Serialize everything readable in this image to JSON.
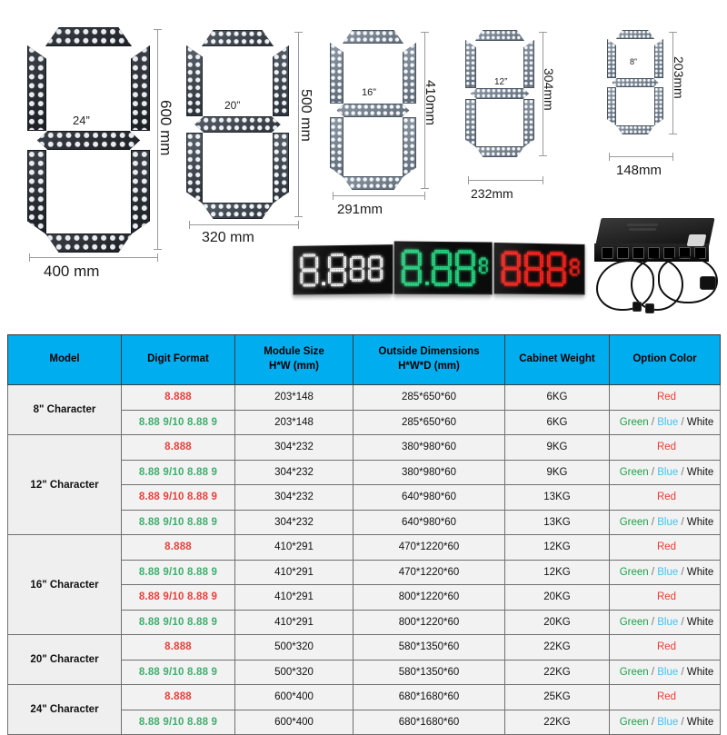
{
  "diagram": {
    "digits": [
      {
        "id": "24in",
        "inch_label": "24”",
        "height_label": "600 mm",
        "width_label": "400 mm",
        "tone": "dark"
      },
      {
        "id": "20in",
        "inch_label": "20”",
        "height_label": "500 mm",
        "width_label": "320 mm",
        "tone": "mid"
      },
      {
        "id": "16in",
        "inch_label": "16”",
        "height_label": "410mm",
        "width_label": "291mm",
        "tone": "light"
      },
      {
        "id": "12in",
        "inch_label": "12”",
        "height_label": "304mm",
        "width_label": "232mm",
        "tone": "light"
      },
      {
        "id": "8in",
        "inch_label": "8”",
        "height_label": "203mm",
        "width_label": "148mm",
        "tone": "light"
      }
    ]
  },
  "signs": [
    {
      "id": "white-sign",
      "color": "#f0f0f0",
      "digits": "8.888"
    },
    {
      "id": "green-sign",
      "color": "#25d07d",
      "digits": "8.88 9"
    },
    {
      "id": "red-sign",
      "color": "#f0231d",
      "digits": "888 9/10"
    }
  ],
  "psu": {
    "name": "led-power-supply-controller"
  },
  "table": {
    "headers": [
      {
        "line1": "Model",
        "line2": ""
      },
      {
        "line1": "Digit Format",
        "line2": ""
      },
      {
        "line1": "Module Size",
        "line2": "H*W (mm)"
      },
      {
        "line1": "Outside Dimensions",
        "line2": "H*W*D (mm)"
      },
      {
        "line1": "Cabinet Weight",
        "line2": ""
      },
      {
        "line1": "Option Color",
        "line2": ""
      }
    ],
    "groups": [
      {
        "model": "8\" Character",
        "rows": [
          {
            "format": "8.888",
            "format_color": "red",
            "module": "203*148",
            "outside": "285*650*60",
            "weight": "6KG",
            "option": "red"
          },
          {
            "format": "8.88 9/10  8.88 9",
            "format_color": "green",
            "module": "203*148",
            "outside": "285*650*60",
            "weight": "6KG",
            "option": "gbw"
          }
        ]
      },
      {
        "model": "12\" Character",
        "rows": [
          {
            "format": "8.888",
            "format_color": "red",
            "module": "304*232",
            "outside": "380*980*60",
            "weight": "9KG",
            "option": "red"
          },
          {
            "format": "8.88 9/10  8.88 9",
            "format_color": "green",
            "module": "304*232",
            "outside": "380*980*60",
            "weight": "9KG",
            "option": "gbw"
          },
          {
            "format": "8.88 9/10  8.88 9",
            "format_color": "red",
            "module": "304*232",
            "outside": "640*980*60",
            "weight": "13KG",
            "option": "red"
          },
          {
            "format": "8.88 9/10  8.88 9",
            "format_color": "green",
            "module": "304*232",
            "outside": "640*980*60",
            "weight": "13KG",
            "option": "gbw"
          }
        ]
      },
      {
        "model": "16\" Character",
        "rows": [
          {
            "format": "8.888",
            "format_color": "red",
            "module": "410*291",
            "outside": "470*1220*60",
            "weight": "12KG",
            "option": "red"
          },
          {
            "format": "8.88 9/10  8.88 9",
            "format_color": "green",
            "module": "410*291",
            "outside": "470*1220*60",
            "weight": "12KG",
            "option": "gbw"
          },
          {
            "format": "8.88 9/10  8.88 9",
            "format_color": "red",
            "module": "410*291",
            "outside": "800*1220*60",
            "weight": "20KG",
            "option": "red"
          },
          {
            "format": "8.88 9/10  8.88 9",
            "format_color": "green",
            "module": "410*291",
            "outside": "800*1220*60",
            "weight": "20KG",
            "option": "gbw"
          }
        ]
      },
      {
        "model": "20\" Character",
        "rows": [
          {
            "format": "8.888",
            "format_color": "red",
            "module": "500*320",
            "outside": "580*1350*60",
            "weight": "22KG",
            "option": "red"
          },
          {
            "format": "8.88 9/10  8.88 9",
            "format_color": "green",
            "module": "500*320",
            "outside": "580*1350*60",
            "weight": "22KG",
            "option": "gbw"
          }
        ]
      },
      {
        "model": "24\" Character",
        "rows": [
          {
            "format": "8.888",
            "format_color": "red",
            "module": "600*400",
            "outside": "680*1680*60",
            "weight": "25KG",
            "option": "red"
          },
          {
            "format": "8.88 9/10  8.88 9",
            "format_color": "green",
            "module": "600*400",
            "outside": "680*1680*60",
            "weight": "22KG",
            "option": "gbw"
          }
        ]
      }
    ],
    "option_labels": {
      "red": "Red",
      "green": "Green",
      "blue": "Blue",
      "white": "White",
      "sep": " / "
    },
    "colors": {
      "header_bg": "#00adee",
      "red": "#ee3b36",
      "green": "#1f9f4a",
      "blue": "#49c2ef",
      "white": "#111111"
    }
  }
}
